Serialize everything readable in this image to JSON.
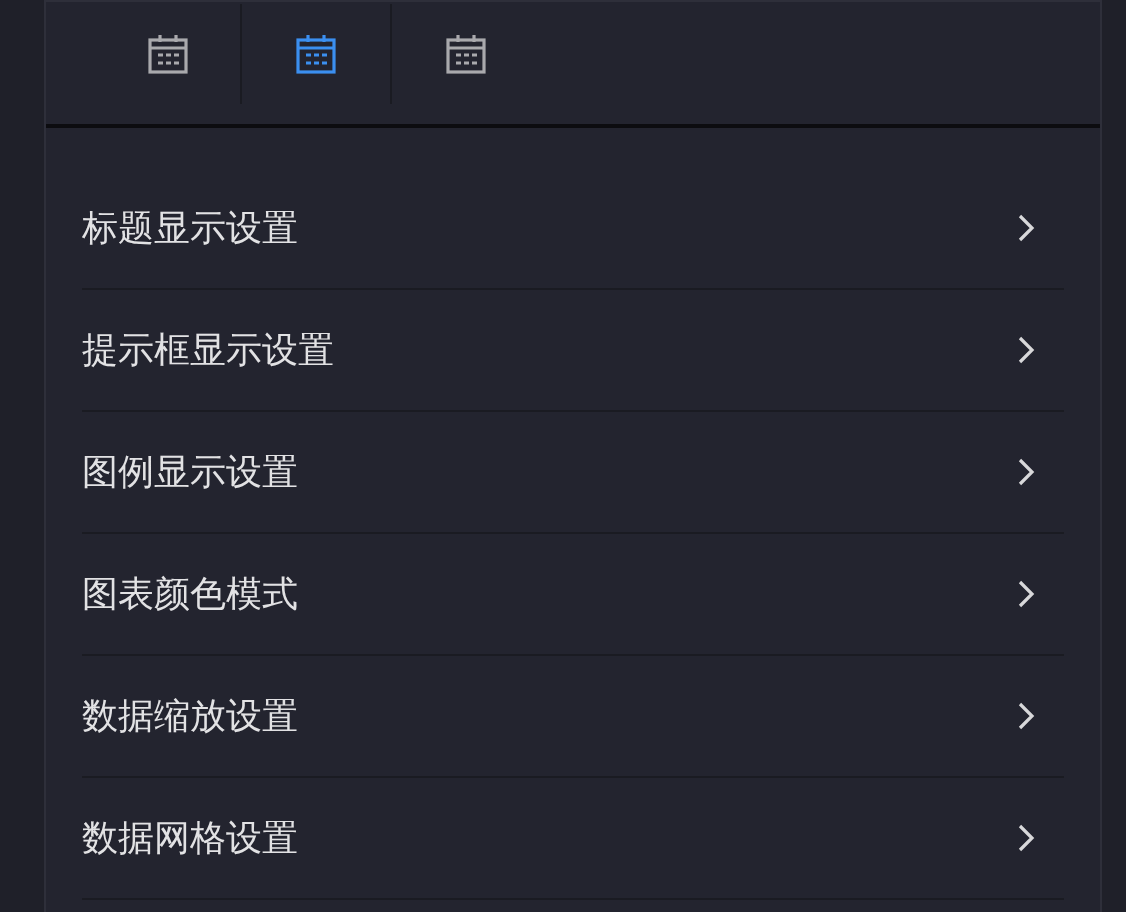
{
  "tabs": [
    {
      "selected": false
    },
    {
      "selected": true
    },
    {
      "selected": false
    }
  ],
  "settings": [
    {
      "label": "标题显示设置"
    },
    {
      "label": "提示框显示设置"
    },
    {
      "label": "图例显示设置"
    },
    {
      "label": "图表颜色模式"
    },
    {
      "label": "数据缩放设置"
    },
    {
      "label": "数据网格设置"
    }
  ]
}
